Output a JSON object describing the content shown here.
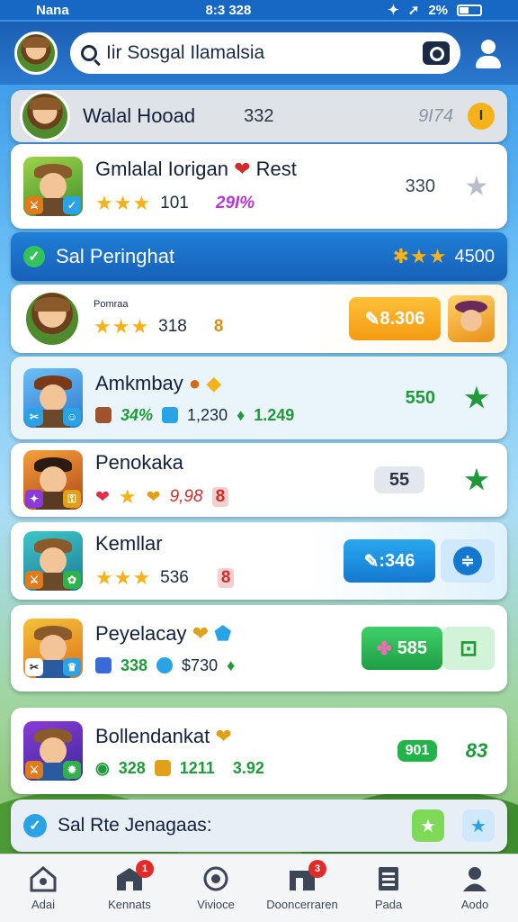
{
  "status": {
    "carrier": "Nana",
    "time": "8:3 328",
    "battery_text": "2%"
  },
  "header": {
    "search_text": "Iir Sosgal Ilamalsia"
  },
  "pinned": {
    "name": "Walal Hooad",
    "value": "332",
    "score": "9I74",
    "badge": "I"
  },
  "game1": {
    "name": "Gmlalal Iorigan",
    "tag": "Rest",
    "rating_count": "101",
    "percent": "29I%",
    "score": "330"
  },
  "section1": {
    "label": "Sal Peringhat",
    "value": "4500"
  },
  "game2": {
    "title_small": "Pomraa",
    "rating_count": "318",
    "rank": "8",
    "price": "8.306"
  },
  "game3": {
    "name": "Amkmbay",
    "stat1": "34%",
    "stat2": "1,230",
    "stat3": "1.249",
    "score": "550"
  },
  "game4": {
    "name": "Penokaka",
    "stat1": "9,98",
    "rank": "8",
    "score": "55"
  },
  "game5": {
    "name": "Kemllar",
    "rating_count": "536",
    "rank": "8",
    "price": ":346"
  },
  "game6": {
    "name": "Peyelacay",
    "stat1": "338",
    "stat2": "$730",
    "price": "585"
  },
  "game7": {
    "name": "Bollendankat",
    "stat1": "328",
    "stat2": "1211",
    "stat3": "3.92",
    "tag": "901",
    "score": "83"
  },
  "section2": {
    "label": "Sal Rte Jenagaas:"
  },
  "nav": {
    "items": [
      {
        "label": "Adai",
        "icon": "home-icon"
      },
      {
        "label": "Kennats",
        "icon": "shop-icon",
        "badge": "1"
      },
      {
        "label": "Vivioce",
        "icon": "compass-icon"
      },
      {
        "label": "Dooncerraren",
        "icon": "store-icon",
        "badge": "3"
      },
      {
        "label": "Pada",
        "icon": "book-icon"
      },
      {
        "label": "Aodo",
        "icon": "profile-icon"
      }
    ]
  },
  "colors": {
    "primary": "#1f7fd6",
    "accent_green": "#1f9a3a",
    "star": "#f6b21a",
    "orange": "#f39a12"
  }
}
